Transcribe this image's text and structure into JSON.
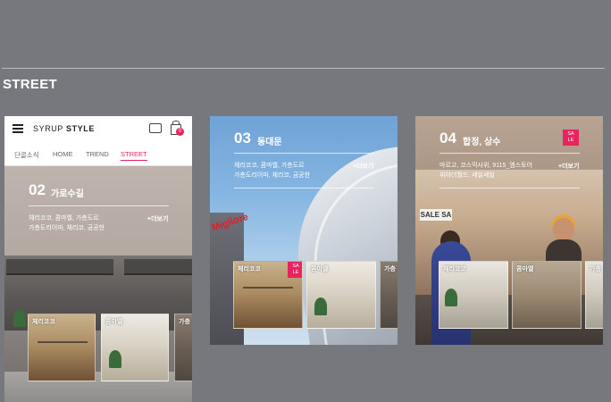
{
  "section": {
    "title": "STREET"
  },
  "colors": {
    "background": "#76787d",
    "accent": "#e8245f"
  },
  "phone": {
    "logo_light": "SYRUP",
    "logo_bold": "STYLE",
    "cart_count": "0",
    "nav": [
      "단골소식",
      "HOME",
      "TREND",
      "STREET"
    ],
    "active_nav": "STREET",
    "card": {
      "number": "02",
      "title": "가로수길",
      "desc_line1": "체리코코, 콤마엘, 가층도르",
      "desc_line2": "가층도리이마, 체리코, 금공한",
      "more": "+더보기"
    },
    "thumbs": [
      "체리코코",
      "콤마엘",
      "가층"
    ]
  },
  "tiles": [
    {
      "number": "03",
      "title": "동대문",
      "desc_line1": "체리코코, 콤마엘, 가층도르",
      "desc_line2": "가층도리이마, 체리코, 금공한",
      "more": "+더보기",
      "sign": "Migliore",
      "thumbs": [
        "체리코코",
        "콤마엘",
        "가층"
      ],
      "sale_badge": [
        "SA",
        "LE"
      ]
    },
    {
      "number": "04",
      "title": "합정, 상수",
      "desc_line1": "마르고, 코스믹사위, 9115_엠스토어",
      "desc_line2": "위아더월드, 세일세일",
      "more": "+더보기",
      "sign": "SALE SA",
      "thumbs": [
        "체리코코",
        "콤마엘",
        "가층"
      ],
      "sale_badge": [
        "SA",
        "LE"
      ]
    }
  ]
}
